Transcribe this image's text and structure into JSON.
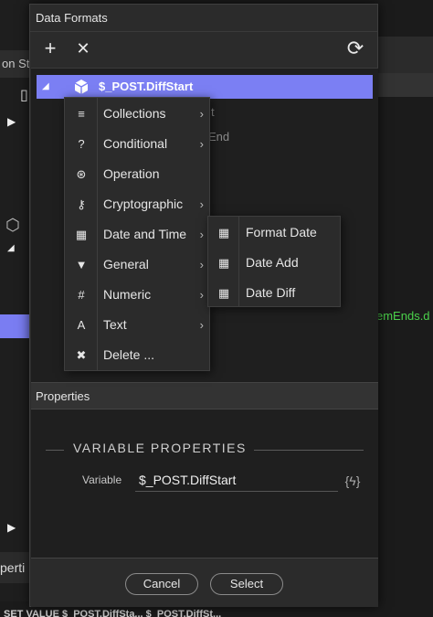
{
  "background": {
    "left_tab_text": "on St",
    "left_panel_text": "perti",
    "right_green_text": "emEnds.d",
    "bottom_text": "SET VALUE                $_POST.DiffSta...    $_POST.DiffSt..."
  },
  "dialog": {
    "title": "Data Formats",
    "toolbar": {
      "add": "+",
      "remove": "✕",
      "refresh": "⟳"
    },
    "tree": {
      "selected_label": "$_POST.DiffStart",
      "ghost_1": "t",
      "ghost_2": "ffEnd"
    },
    "properties": {
      "header": "Properties",
      "section_title": "VARIABLE PROPERTIES",
      "variable_label": "Variable",
      "variable_value": "$_POST.DiffStart"
    },
    "buttons": {
      "cancel": "Cancel",
      "select": "Select"
    }
  },
  "menu": {
    "items": [
      {
        "label": "Collections",
        "icon": "list-icon",
        "glyph": "≡",
        "submenu": true
      },
      {
        "label": "Conditional",
        "icon": "question-icon",
        "glyph": "?",
        "submenu": true
      },
      {
        "label": "Operation",
        "icon": "operation-icon",
        "glyph": "⊛",
        "submenu": false
      },
      {
        "label": "Cryptographic",
        "icon": "key-icon",
        "glyph": "⚷",
        "submenu": true
      },
      {
        "label": "Date and Time",
        "icon": "calendar-icon",
        "glyph": "▦",
        "submenu": true
      },
      {
        "label": "General",
        "icon": "funnel-icon",
        "glyph": "▼",
        "submenu": true
      },
      {
        "label": "Numeric",
        "icon": "hash-icon",
        "glyph": "#",
        "submenu": true
      },
      {
        "label": "Text",
        "icon": "text-icon",
        "glyph": "A",
        "submenu": true
      },
      {
        "label": "Delete ...",
        "icon": "delete-icon",
        "glyph": "✖",
        "submenu": false
      }
    ],
    "chevron": "›"
  },
  "submenu": {
    "items": [
      {
        "label": "Format Date",
        "icon": "calendar-icon",
        "glyph": "▦"
      },
      {
        "label": "Date Add",
        "icon": "calendar-icon",
        "glyph": "▦"
      },
      {
        "label": "Date Diff",
        "icon": "calendar-icon",
        "glyph": "▦"
      }
    ]
  },
  "colors": {
    "selection": "#7b7ff3",
    "background": "#2b2b2b",
    "panel": "#1f1f1f",
    "green_text": "#4bd24b"
  }
}
